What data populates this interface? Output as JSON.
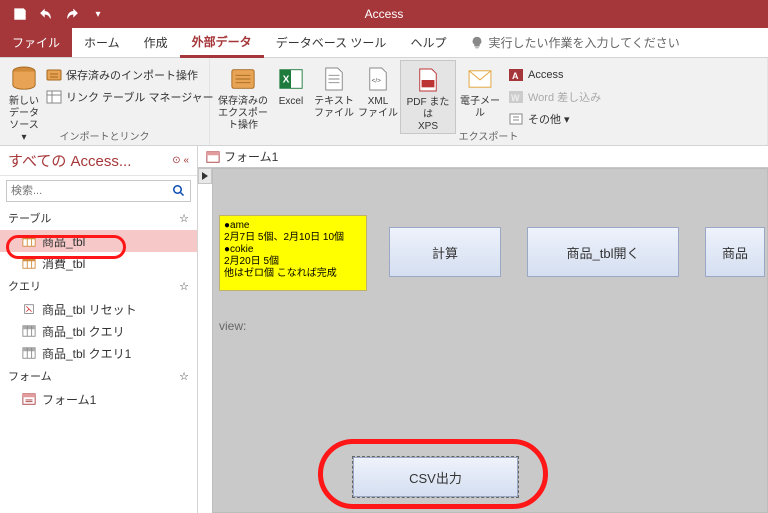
{
  "qat": {
    "title": "Access"
  },
  "tabs": {
    "file": "ファイル",
    "home": "ホーム",
    "create": "作成",
    "external": "外部データ",
    "dbtools": "データベース ツール",
    "help": "ヘルプ",
    "tellme": "実行したい作業を入力してください"
  },
  "ribbon": {
    "import": {
      "new_source": "新しいデータ\nソース ▾",
      "saved_imports": "保存済みのインポート操作",
      "link_manager": "リンク テーブル マネージャー",
      "group_label": "インポートとリンク"
    },
    "export": {
      "saved_exports": "保存済みの\nエクスポート操作",
      "excel": "Excel",
      "text": "テキスト\nファイル",
      "xml": "XML\nファイル",
      "pdf": "PDF または\nXPS",
      "email": "電子メール",
      "access": "Access",
      "word": "Word 差し込み",
      "other": "その他 ▾",
      "group_label": "エクスポート"
    }
  },
  "nav": {
    "header": "すべての Access...",
    "search_placeholder": "検索...",
    "cats": {
      "tables": "テーブル",
      "queries": "クエリ",
      "forms": "フォーム"
    },
    "items": {
      "t1": "商品_tbl",
      "t2": "消費_tbl",
      "q1": "商品_tbl リセット",
      "q2": "商品_tbl クエリ",
      "q3": "商品_tbl クエリ1",
      "f1": "フォーム1"
    }
  },
  "form": {
    "tab": "フォーム1",
    "note": "●ame\n2月7日 5個、2月10日 10個\n●cokie\n2月20日 5個\n他はゼロ個 こなれば完成",
    "btn_calc": "計算",
    "btn_open": "商品_tbl開く",
    "btn_item": "商品",
    "view_label": "view:",
    "btn_csv": "CSV出力"
  }
}
